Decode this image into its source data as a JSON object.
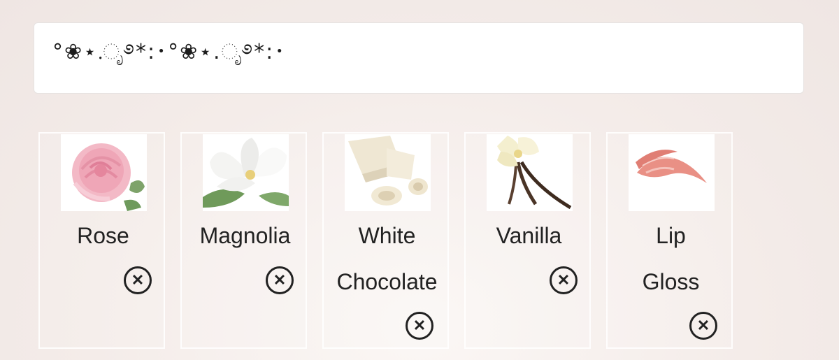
{
  "search": {
    "value": "°❀⋆.ೃ࿔*:･°❀⋆.ೃ࿔*:･"
  },
  "notes": [
    {
      "label_lines": [
        "Rose"
      ],
      "image": "pink-rose",
      "remove_icon": "close-circle-icon"
    },
    {
      "label_lines": [
        "Magnolia"
      ],
      "image": "white-magnolia",
      "remove_icon": "close-circle-icon"
    },
    {
      "label_lines": [
        "White",
        "Chocolate"
      ],
      "image": "white-chocolate",
      "remove_icon": "close-circle-icon"
    },
    {
      "label_lines": [
        "Vanilla"
      ],
      "image": "vanilla-pods",
      "remove_icon": "close-circle-icon"
    },
    {
      "label_lines": [
        "Lip",
        "Gloss"
      ],
      "image": "lip-gloss-swatch",
      "remove_icon": "close-circle-icon"
    }
  ],
  "colors": {
    "text": "#222222",
    "tile_border": "#ffffff",
    "background": "#f4ece9"
  }
}
